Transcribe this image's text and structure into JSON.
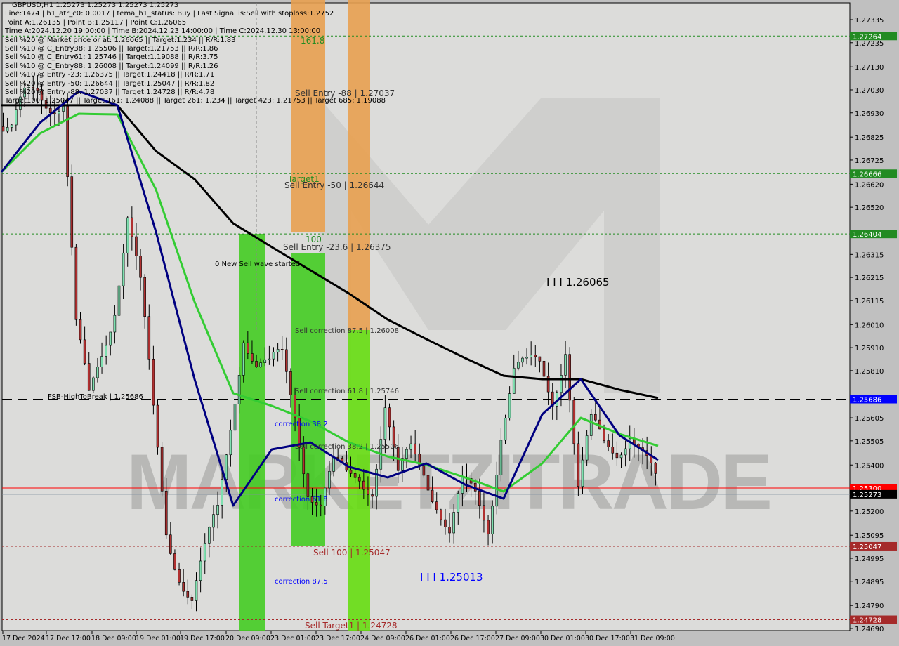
{
  "chart_data": {
    "type": "candlestick",
    "symbol": "GBPUSD,H1",
    "title": "GBPUSD,H1  1.25273 1.25273 1.25273 1.25273",
    "ylim": [
      1.2469,
      1.2738
    ],
    "y_ticks": [
      "1.27335",
      "1.27235",
      "1.27130",
      "1.27030",
      "1.26930",
      "1.26825",
      "1.26725",
      "1.26620",
      "1.26520",
      "1.26315",
      "1.26215",
      "1.26115",
      "1.26010",
      "1.25910",
      "1.25810",
      "1.25605",
      "1.25505",
      "1.25400",
      "1.25200",
      "1.25095",
      "1.24995",
      "1.24895",
      "1.24790",
      "1.24690"
    ],
    "x_ticks": [
      "17 Dec 2024",
      "17 Dec 17:00",
      "18 Dec 09:00",
      "19 Dec 01:00",
      "19 Dec 17:00",
      "20 Dec 09:00",
      "23 Dec 01:00",
      "23 Dec 17:00",
      "24 Dec 09:00",
      "26 Dec 01:00",
      "26 Dec 17:00",
      "27 Dec 09:00",
      "30 Dec 01:00",
      "30 Dec 17:00",
      "31 Dec 09:00"
    ],
    "closes": [
      1.2687,
      1.2681,
      1.2696,
      1.2705,
      1.2702,
      1.2699,
      1.2596,
      1.2565,
      1.259,
      1.2614,
      1.265,
      1.2614,
      1.2559,
      1.2513,
      1.2498,
      1.2483,
      1.2498,
      1.2516,
      1.2559,
      1.2602,
      1.2584,
      1.2578,
      1.2584,
      1.2565,
      1.2535,
      1.2523,
      1.2535,
      1.2532,
      1.2538,
      1.2535,
      1.2565,
      1.2529,
      1.2544,
      1.2541,
      1.2529,
      1.251,
      1.2526,
      1.2524,
      1.2516,
      1.2559,
      1.2581,
      1.2578,
      1.2581,
      1.2572,
      1.2596,
      1.2529,
      1.2553,
      1.2547,
      1.255,
      1.2559,
      1.2544,
      1.25273
    ],
    "series": [
      {
        "color": "#000000",
        "values": [
          1.26963,
          1.26963,
          1.26963,
          1.26963,
          1.26764,
          1.26642,
          1.2645,
          1.26347,
          1.26246,
          1.26145,
          1.26032,
          1.25947,
          1.25865,
          1.25788,
          1.25773,
          1.25773,
          1.25727,
          1.25691
        ]
      },
      {
        "color": "#33cc33",
        "values": [
          1.26673,
          1.26841,
          1.26926,
          1.26923,
          1.26597,
          1.26109,
          1.25712,
          1.25657,
          1.2559,
          1.25498,
          1.25437,
          1.25401,
          1.25346,
          1.25285,
          1.25407,
          1.25605,
          1.25535,
          1.25483
        ]
      },
      {
        "color": "#000080",
        "values": [
          1.26673,
          1.26887,
          1.27024,
          1.26963,
          1.26414,
          1.25773,
          1.25224,
          1.25468,
          1.25498,
          1.25392,
          1.25346,
          1.25407,
          1.25315,
          1.25254,
          1.2562,
          1.25773,
          1.25529,
          1.25422
        ]
      }
    ],
    "levels": [
      {
        "price": 1.27264,
        "label": "1.27264",
        "color": "#228b22"
      },
      {
        "price": 1.26666,
        "label": "1.26666",
        "color": "#228b22"
      },
      {
        "price": 1.26404,
        "label": "1.26404",
        "color": "#228b22"
      },
      {
        "price": 1.25686,
        "label": "1.25686",
        "color": "#0000ff"
      },
      {
        "price": 1.253,
        "label": "1.25300",
        "color": "#ff0000"
      },
      {
        "price": 1.25273,
        "label": "1.25273",
        "color": "#000000"
      },
      {
        "price": 1.25047,
        "label": "1.25047",
        "color": "#a52a2a"
      },
      {
        "price": 1.24728,
        "label": "1.24728",
        "color": "#a52a2a"
      }
    ],
    "annotations": {
      "fib_161": "161.8",
      "sell_entry_88": "Sell Entry -88 | 1.27037",
      "target1": "Target1",
      "sell_entry_50": "Sell Entry -50 | 1.26644",
      "fib_100": "100",
      "sell_entry_236": "Sell Entry -23.6 | 1.26375",
      "new_wave": "0 New Sell wave started",
      "point_c": "I I I 1.26065",
      "sell_corr_875": "Sell correction 87.5 | 1.26008",
      "fsb": "FSB-HighToBreak | 1.25686",
      "sell_corr_618": "Sell correction 61.8 | 1.25746",
      "corr_382": "correction 38.2",
      "sell_corr_382": "Sell correction 38.2 | 1.25506",
      "corr_618": "correction 61.8",
      "sell_100": "Sell 100 | 1.25047",
      "corr_875": "correction 87.5",
      "point_b": "I I I 1.25013",
      "sell_target1": "Sell Target1 | 1.24728"
    },
    "watermark": "MARKETZITRADE"
  },
  "info": [
    "Line:1474 | h1_atr_c0: 0.0017 | tema_h1_status: Buy | Last Signal is:Sell with stoploss:1.2752",
    "Point A:1.26135 | Point B:1.25117 | Point C:1.26065",
    "Time A:2024.12.20 19:00:00 | Time B:2024.12.23 14:00:00 | Time C:2024.12.30 13:00:00",
    "Sell %20 @ Market price or at: 1.26065 || Target:1.234 || R/R:1.83",
    "Sell %10 @ C_Entry38: 1.25506 || Target:1.21753 || R/R:1.86",
    "Sell %10 @ C_Entry61: 1.25746 || Target:1.19088 || R/R:3.75",
    "Sell %10 @ C_Entry88: 1.26008 || Target:1.24099 || R/R:1.26",
    "Sell %10 @ Entry -23: 1.26375 || Target:1.24418 || R/R:1.71",
    "Sell %20 @ Entry -50: 1.26644 || Target:1.25047 || R/R:1.82",
    "Sell %20 @ Entry -88: 1.27037 || Target:1.24728 || R/R:4.78",
    "Target100: 1.25047 || Target 161: 1.24088 || Target 261: 1.234 || Target 423: 1.21753 || Target 685: 1.19088"
  ]
}
